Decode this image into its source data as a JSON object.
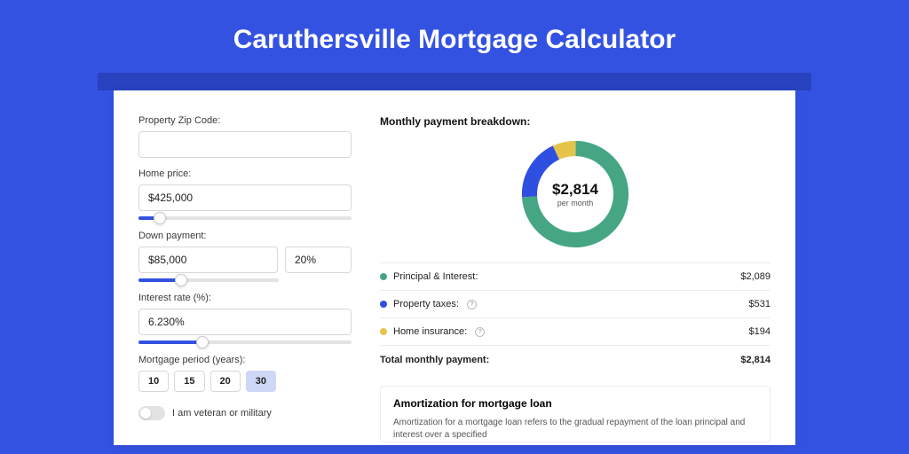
{
  "header": {
    "title": "Caruthersville Mortgage Calculator"
  },
  "form": {
    "zip": {
      "label": "Property Zip Code:",
      "value": ""
    },
    "home_price": {
      "label": "Home price:",
      "value": "$425,000",
      "slider_pct": 10
    },
    "down_payment": {
      "label": "Down payment:",
      "amount": "$85,000",
      "pct": "20%",
      "slider_pct": 20
    },
    "interest_rate": {
      "label": "Interest rate (%):",
      "value": "6.230%",
      "slider_pct": 30
    },
    "mortgage_period": {
      "label": "Mortgage period (years):",
      "options": [
        "10",
        "15",
        "20",
        "30"
      ],
      "selected": "30"
    },
    "veteran": {
      "label": "I am veteran or military",
      "checked": false
    }
  },
  "breakdown": {
    "title": "Monthly payment breakdown:",
    "donut_amount": "$2,814",
    "donut_per": "per month",
    "items": [
      {
        "label": "Principal & Interest:",
        "value": "$2,089",
        "color": "green",
        "help": false
      },
      {
        "label": "Property taxes:",
        "value": "$531",
        "color": "blue",
        "help": true
      },
      {
        "label": "Home insurance:",
        "value": "$194",
        "color": "yellow",
        "help": true
      }
    ],
    "total_label": "Total monthly payment:",
    "total_value": "$2,814"
  },
  "amort": {
    "title": "Amortization for mortgage loan",
    "body": "Amortization for a mortgage loan refers to the gradual repayment of the loan principal and interest over a specified"
  },
  "chart_data": {
    "type": "pie",
    "title": "Monthly payment breakdown",
    "total": 2814,
    "series": [
      {
        "name": "Principal & Interest",
        "value": 2089,
        "color": "#46a683"
      },
      {
        "name": "Property taxes",
        "value": 531,
        "color": "#2f4fe0"
      },
      {
        "name": "Home insurance",
        "value": 194,
        "color": "#e6c44c"
      }
    ]
  }
}
